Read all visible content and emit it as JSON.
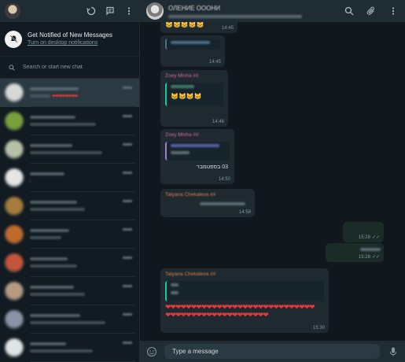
{
  "sidebar": {
    "notification": {
      "title": "Get Notified of New Messages",
      "link": "Turn on desktop notifications"
    },
    "search": {
      "placeholder": "Search or start new chat"
    },
    "chats": [
      {
        "avatar_color": "#d8d8d8",
        "active": true,
        "hearts": "❤❤❤❤❤❤❤❤"
      },
      {
        "avatar_color": "#7aa03d"
      },
      {
        "avatar_color": "#b8c0a8"
      },
      {
        "avatar_color": "#e5e5e5"
      },
      {
        "avatar_color": "#a67b3c"
      },
      {
        "avatar_color": "#c06a2b"
      },
      {
        "avatar_color": "#c4553a"
      },
      {
        "avatar_color": "#b79a82"
      },
      {
        "avatar_color": "#8c93a8"
      },
      {
        "avatar_color": "#e1e4e6"
      }
    ]
  },
  "header": {
    "contact_name": "ОЛЕНИЕ ОООНИ"
  },
  "messages": {
    "m1": {
      "emoji": "😸😸😸😸😸",
      "time": "14:45"
    },
    "m2": {
      "time": "14:45"
    },
    "m3": {
      "sender": "Zoey Misha ##",
      "emoji": "😸😸😸😸",
      "time": "14:46"
    },
    "m4": {
      "sender": "Zoey Misha ##",
      "body": "03 בספטמבר",
      "time": "14:50"
    },
    "m5": {
      "sender": "Tatyana Chekaleva ##",
      "time": "14:58"
    },
    "m6": {
      "time": "15:28"
    },
    "m7": {
      "time": "15:28"
    },
    "m8": {
      "sender": "Tatyana Chekaleva ##",
      "hearts": "❤❤❤❤❤❤❤❤❤❤❤❤❤❤❤❤❤❤❤❤❤❤❤❤❤❤❤❤❤❤❤❤❤❤❤❤❤❤❤❤❤❤❤❤❤❤❤❤❤",
      "time": "15:30"
    }
  },
  "composer": {
    "placeholder": "Type a message"
  },
  "colors": {
    "accent": "#06cf9c",
    "sender_pink": "#d96c97",
    "sender_orange": "#d9804a",
    "heart": "#e8373d"
  }
}
